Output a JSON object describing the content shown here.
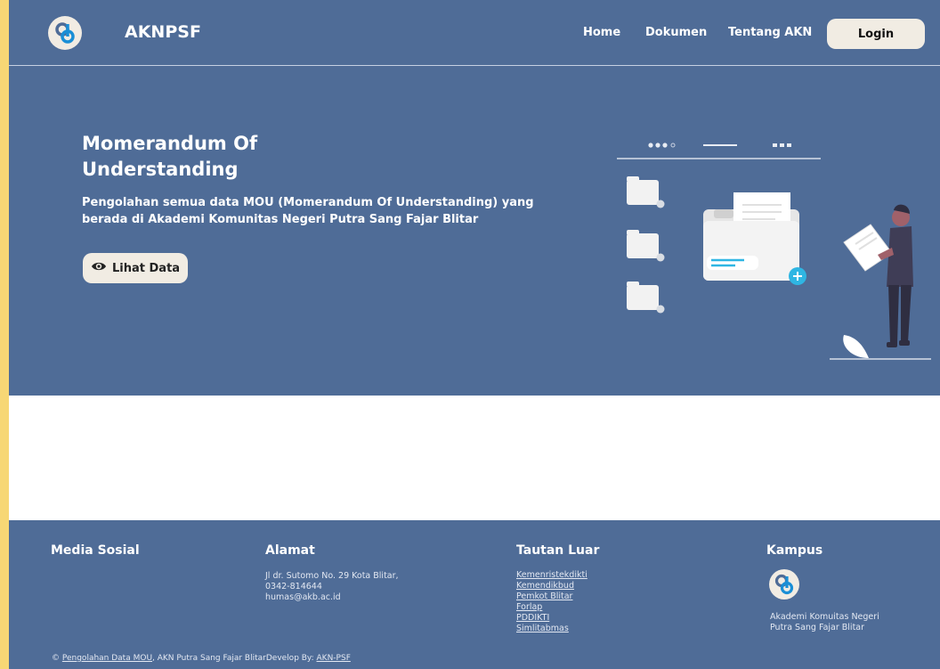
{
  "header": {
    "brand": "AKNPSF",
    "nav": [
      "Home",
      "Dokumen",
      "Tentang AKN"
    ],
    "login_label": "Login"
  },
  "hero": {
    "title_line1": "Momerandum Of",
    "title_line2": "Understanding",
    "subtitle": "Pengolahan semua data MOU (Momerandum Of Understanding) yang berada di Akademi Komunitas Negeri Putra Sang Fajar Blitar",
    "cta_label": "Lihat Data",
    "cta_icon": "eye-icon"
  },
  "footer": {
    "media_sosial": {
      "heading": "Media Sosial"
    },
    "alamat": {
      "heading": "Alamat",
      "lines": [
        "Jl dr. Sutomo No. 29 Kota Blitar,",
        "0342-814644",
        "humas@akb.ac.id"
      ]
    },
    "tautan_luar": {
      "heading": "Tautan Luar",
      "links": [
        "Kemenristekdikti",
        "Kemendikbud",
        "Pemkot Blitar",
        "Forlap",
        "PDDIKTI",
        "Simlitabmas"
      ]
    },
    "kampus": {
      "heading": "Kampus",
      "name_line1": "Akademi Komuitas Negeri",
      "name_line2": "Putra Sang Fajar Blitar"
    },
    "copyright": {
      "symbol": "©",
      "link1": "Pengolahan Data MOU",
      "middle": ", AKN Putra Sang Fajar BlitarDevelop By: ",
      "link2": "AKN-PSF"
    }
  },
  "colors": {
    "primary": "#4f6c97",
    "accent_bg": "#f1ece3",
    "border": "#f7d775"
  }
}
